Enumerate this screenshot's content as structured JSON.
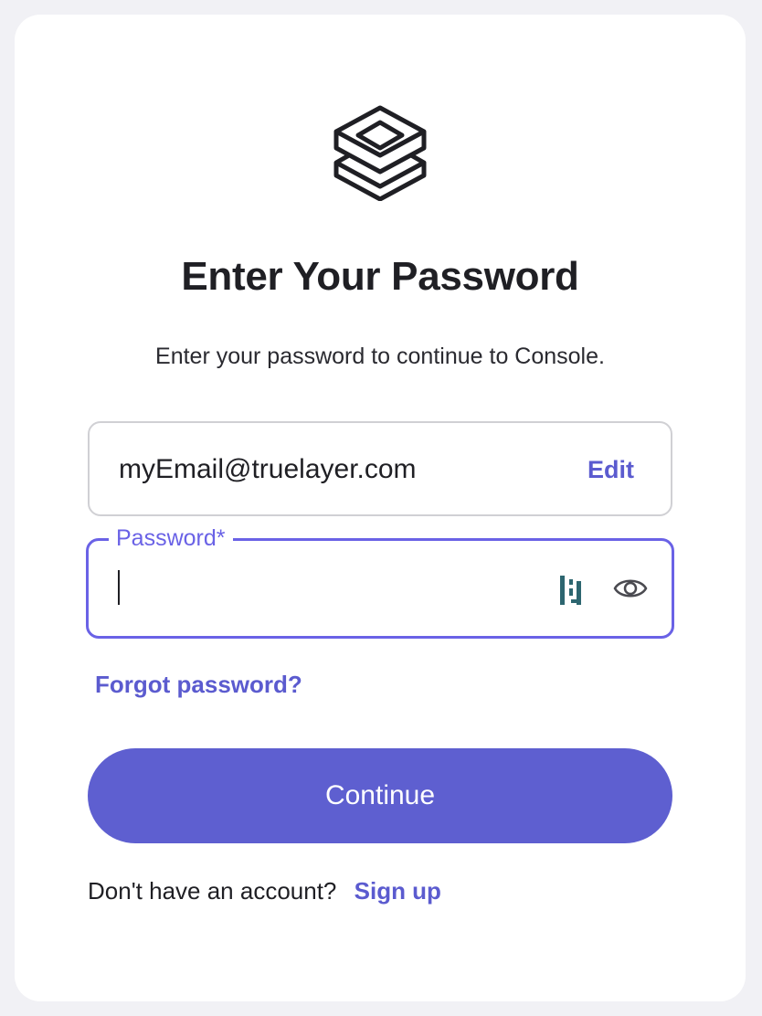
{
  "heading": {
    "title": "Enter Your Password",
    "subtitle": "Enter your password to continue to Console."
  },
  "email": {
    "value": "myEmail@truelayer.com",
    "edit_label": "Edit"
  },
  "password": {
    "label": "Password*",
    "value": ""
  },
  "links": {
    "forgot_password": "Forgot password?"
  },
  "actions": {
    "continue_label": "Continue"
  },
  "signup": {
    "prompt": "Don't have an account?",
    "link_label": "Sign up"
  },
  "icons": {
    "logo": "stacked-layers-logo-icon",
    "password_manager": "password-manager-icon",
    "visibility": "eye-icon"
  },
  "colors": {
    "accent": "#5e5fd0",
    "focus_border": "#6a62e6",
    "text": "#1f1f24"
  }
}
